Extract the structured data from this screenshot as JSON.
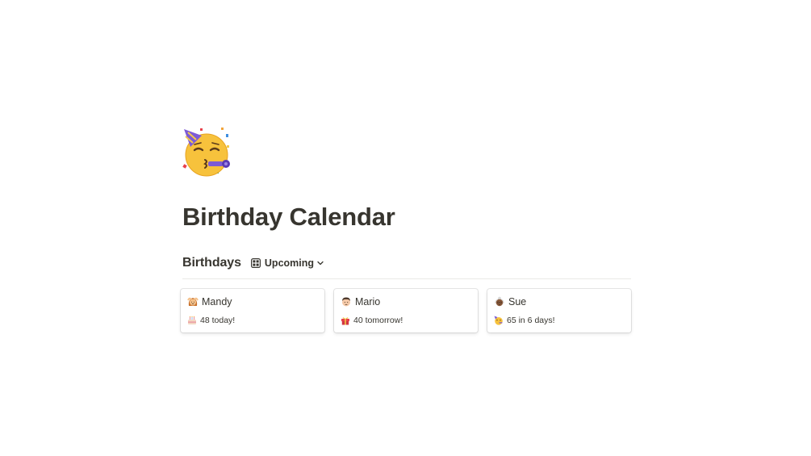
{
  "page": {
    "icon": "partying-face-icon",
    "title": "Birthday Calendar"
  },
  "database": {
    "title": "Birthdays",
    "view": {
      "icon": "gallery-grid-icon",
      "label": "Upcoming",
      "dropdown_icon": "chevron-down-icon"
    }
  },
  "cards": [
    {
      "name": "Mandy",
      "name_icon": "woman-gesturing-ok-icon",
      "status_icon": "birthday-cake-icon",
      "status": "48 today!"
    },
    {
      "name": "Mario",
      "name_icon": "man-face-icon",
      "status_icon": "wrapped-gift-icon",
      "status": "40 tomorrow!"
    },
    {
      "name": "Sue",
      "name_icon": "older-woman-icon",
      "status_icon": "partying-face-icon",
      "status": "65 in 6 days!"
    }
  ],
  "colors": {
    "text": "#37352f",
    "divider": "#e9e9e7",
    "emoji_yellow": "#f7c23c",
    "party_hat_purple": "#7d5bd6"
  }
}
